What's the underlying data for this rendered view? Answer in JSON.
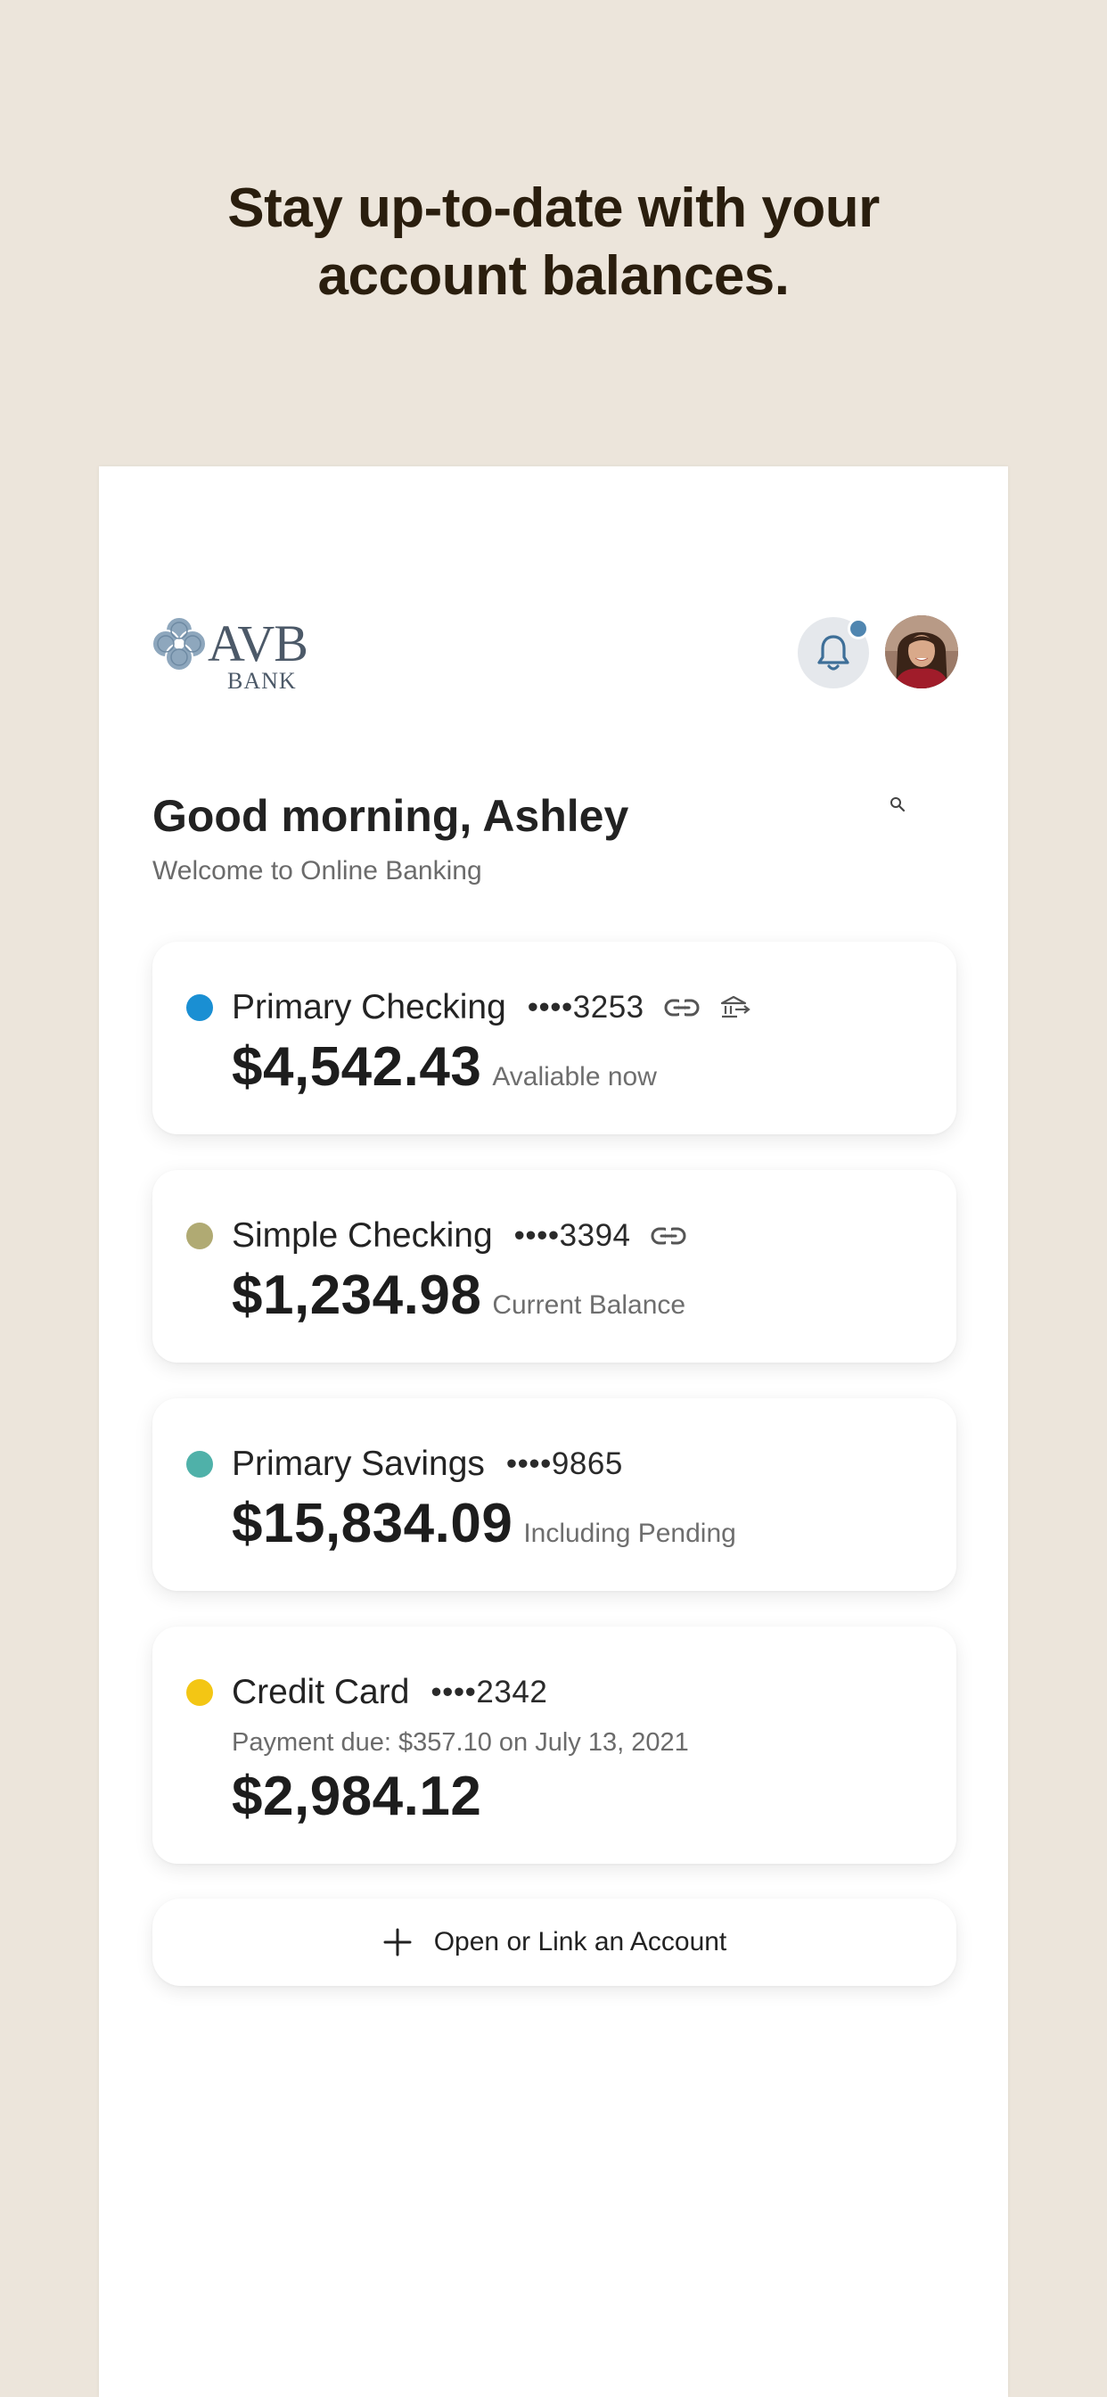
{
  "promo": {
    "headline_line1": "Stay up-to-date with your",
    "headline_line2": "account balances."
  },
  "header": {
    "logo_text": "AVB",
    "logo_subtext": "BANK",
    "bell_icon": "bell-icon",
    "notification_indicator": true
  },
  "greeting": {
    "title": "Good morning, Ashley",
    "subtitle": "Welcome to Online Banking"
  },
  "accounts": [
    {
      "name": "Primary Checking",
      "mask": "••••3253",
      "balance": "$4,542.43",
      "note": "Avaliable now",
      "dot_color": "#1a8fd3",
      "icons": [
        "link-icon",
        "bank-transfer-icon"
      ]
    },
    {
      "name": "Simple Checking",
      "mask": "••••3394",
      "balance": "$1,234.98",
      "note": "Current Balance",
      "dot_color": "#b0aa73",
      "icons": [
        "link-icon"
      ]
    },
    {
      "name": "Primary Savings",
      "mask": "••••9865",
      "balance": "$15,834.09",
      "note": "Including Pending",
      "dot_color": "#4fb1a9",
      "icons": []
    },
    {
      "name": "Credit Card",
      "mask": "••••2342",
      "due": "Payment due: $357.10 on July 13, 2021",
      "balance": "$2,984.12",
      "dot_color": "#f3c614",
      "icons": []
    }
  ],
  "add_account": {
    "label": "Open or Link an Account",
    "icon": "plus-icon"
  },
  "colors": {
    "background": "#ece5db",
    "headline": "#2a1e0e",
    "brand": "#4c5968",
    "notification_dot": "#5086b0"
  }
}
